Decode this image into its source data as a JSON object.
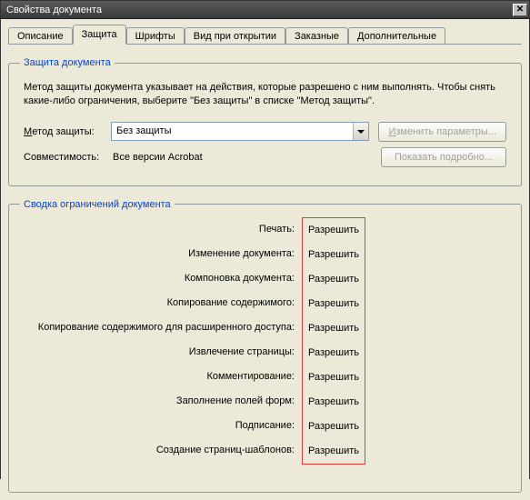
{
  "window": {
    "title": "Свойства документа"
  },
  "tabs": {
    "t0": "Описание",
    "t1": "Защита",
    "t2": "Шрифты",
    "t3": "Вид при открытии",
    "t4": "Заказные",
    "t5": "Дополнительные"
  },
  "section1": {
    "legend": "Защита документа",
    "desc": "Метод защиты документа указывает на действия, которые разрешено с ним выполнять. Чтобы снять какие-либо ограничения, выберите \"Без защиты\" в списке \"Метод защиты\".",
    "method_label_pre": "М",
    "method_label_rest": "етод защиты:",
    "method_value": "Без защиты",
    "compat_label": "Совместимость:",
    "compat_value": "Все версии Acrobat",
    "btn_change_pre": "И",
    "btn_change_rest": "зменить параметры...",
    "btn_details": "Показать подробно..."
  },
  "section2": {
    "legend": "Сводка ограничений документа",
    "rows": {
      "r0": {
        "label": "Печать:",
        "value": "Разрешить"
      },
      "r1": {
        "label": "Изменение документа:",
        "value": "Разрешить"
      },
      "r2": {
        "label": "Компоновка документа:",
        "value": "Разрешить"
      },
      "r3": {
        "label": "Копирование содержимого:",
        "value": "Разрешить"
      },
      "r4": {
        "label": "Копирование содержимого для расширенного доступа:",
        "value": "Разрешить"
      },
      "r5": {
        "label": "Извлечение страницы:",
        "value": "Разрешить"
      },
      "r6": {
        "label": "Комментирование:",
        "value": "Разрешить"
      },
      "r7": {
        "label": "Заполнение полей форм:",
        "value": "Разрешить"
      },
      "r8": {
        "label": "Подписание:",
        "value": "Разрешить"
      },
      "r9": {
        "label": "Создание страниц-шаблонов:",
        "value": "Разрешить"
      }
    }
  }
}
